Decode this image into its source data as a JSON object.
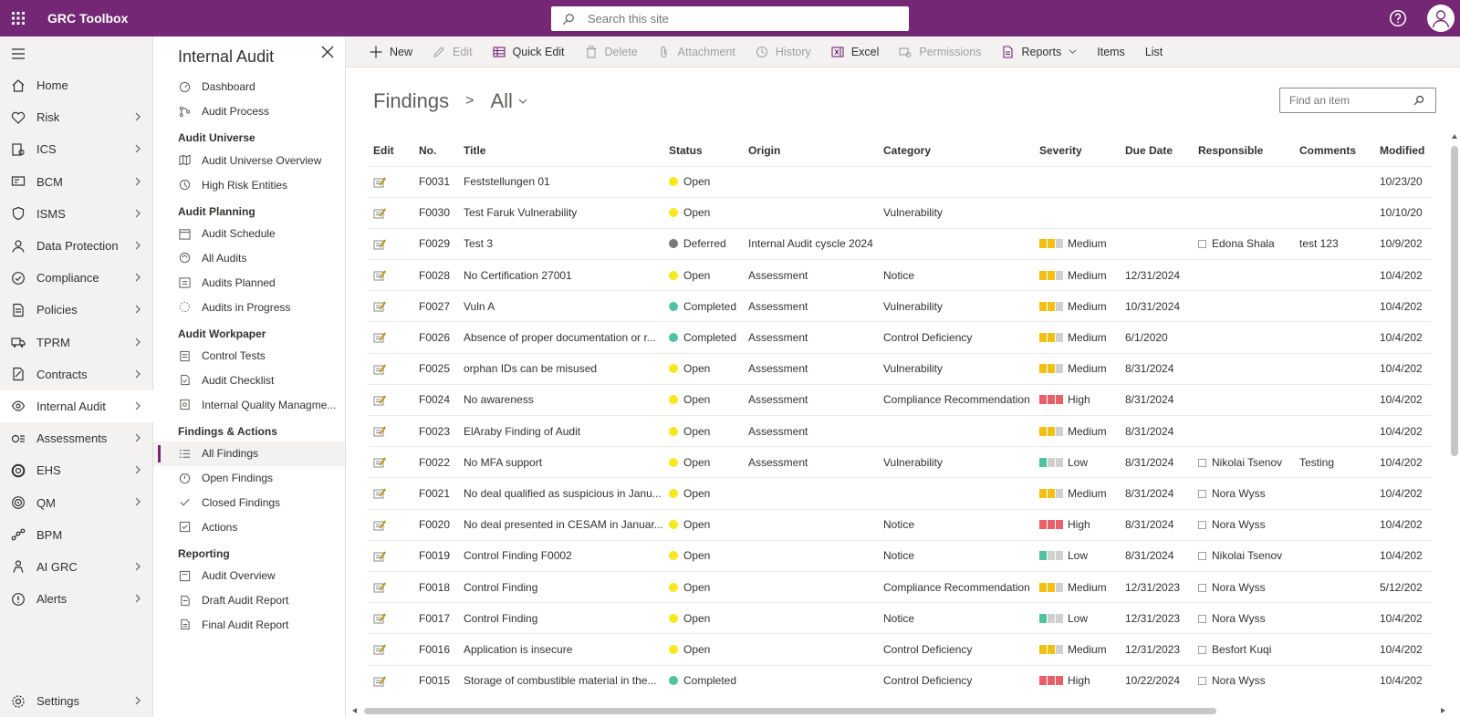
{
  "header": {
    "app_title": "GRC Toolbox",
    "search_placeholder": "Search this site"
  },
  "leftnav": {
    "items": [
      {
        "label": "Home",
        "icon": "home-icon",
        "chevron": false
      },
      {
        "label": "Risk",
        "icon": "risk-icon",
        "chevron": true
      },
      {
        "label": "ICS",
        "icon": "ics-icon",
        "chevron": true
      },
      {
        "label": "BCM",
        "icon": "bcm-icon",
        "chevron": true
      },
      {
        "label": "ISMS",
        "icon": "shield-icon",
        "chevron": true
      },
      {
        "label": "Data Protection",
        "icon": "person-icon",
        "chevron": true
      },
      {
        "label": "Compliance",
        "icon": "check-circle-icon",
        "chevron": true
      },
      {
        "label": "Policies",
        "icon": "policy-icon",
        "chevron": true
      },
      {
        "label": "TPRM",
        "icon": "truck-icon",
        "chevron": true
      },
      {
        "label": "Contracts",
        "icon": "contract-icon",
        "chevron": true
      },
      {
        "label": "Internal Audit",
        "icon": "eye-icon",
        "chevron": true
      },
      {
        "label": "Assessments",
        "icon": "assessment-icon",
        "chevron": true
      },
      {
        "label": "EHS",
        "icon": "lifebuoy-icon",
        "chevron": true
      },
      {
        "label": "QM",
        "icon": "target-icon",
        "chevron": true
      },
      {
        "label": "BPM",
        "icon": "flow-icon",
        "chevron": false
      },
      {
        "label": "AI GRC",
        "icon": "robot-icon",
        "chevron": true
      },
      {
        "label": "Alerts",
        "icon": "alert-icon",
        "chevron": true
      }
    ],
    "settings_label": "Settings"
  },
  "subnav": {
    "title": "Internal Audit",
    "top_items": [
      "Dashboard",
      "Audit Process"
    ],
    "groups": [
      {
        "heading": "Audit Universe",
        "items": [
          "Audit Universe Overview",
          "High Risk Entities"
        ]
      },
      {
        "heading": "Audit Planning",
        "items": [
          "Audit Schedule",
          "All Audits",
          "Audits Planned",
          "Audits in Progress"
        ]
      },
      {
        "heading": "Audit Workpaper",
        "items": [
          "Control Tests",
          "Audit Checklist",
          "Internal Quality Managme..."
        ]
      },
      {
        "heading": "Findings & Actions",
        "items": [
          "All Findings",
          "Open Findings",
          "Closed Findings",
          "Actions"
        ]
      },
      {
        "heading": "Reporting",
        "items": [
          "Audit Overview",
          "Draft Audit Report",
          "Final Audit Report"
        ]
      }
    ]
  },
  "commandbar": {
    "new": "New",
    "edit": "Edit",
    "quick_edit": "Quick Edit",
    "delete": "Delete",
    "attachment": "Attachment",
    "history": "History",
    "excel": "Excel",
    "permissions": "Permissions",
    "reports": "Reports",
    "items": "Items",
    "list": "List"
  },
  "main": {
    "list_name": "Findings",
    "separator": ">",
    "view_name": "All",
    "find_placeholder": "Find an item",
    "columns": [
      "Edit",
      "No.",
      "Title",
      "Status",
      "Origin",
      "Category",
      "Severity",
      "Due Date",
      "Responsible",
      "Comments",
      "Modified"
    ],
    "status_colors": {
      "Open": "#f8e71c",
      "Completed": "#4fc3a1",
      "Deferred": "#797775"
    },
    "severity_colors": {
      "Medium": [
        "#f2c014",
        "#f2c014",
        "#d2d0ce"
      ],
      "High": [
        "#e8606a",
        "#e8606a",
        "#e8606a"
      ],
      "Low": [
        "#4fc3a1",
        "#d2d0ce",
        "#d2d0ce"
      ]
    },
    "rows": [
      {
        "no": "F0031",
        "title": "Feststellungen 01",
        "status": "Open",
        "origin": "",
        "category": "",
        "severity": "",
        "due": "",
        "responsible": "",
        "comments": "",
        "modified": "10/23/20"
      },
      {
        "no": "F0030",
        "title": "Test Faruk Vulnerability",
        "status": "Open",
        "origin": "",
        "category": "Vulnerability",
        "severity": "",
        "due": "",
        "responsible": "",
        "comments": "",
        "modified": "10/10/20"
      },
      {
        "no": "F0029",
        "title": "Test 3",
        "status": "Deferred",
        "origin": "Internal Audit cyscle 2024",
        "category": "",
        "severity": "Medium",
        "due": "",
        "responsible": "Edona Shala",
        "comments": "test 123",
        "modified": "10/9/202"
      },
      {
        "no": "F0028",
        "title": "No Certification 27001",
        "status": "Open",
        "origin": "Assessment",
        "category": "Notice",
        "severity": "Medium",
        "due": "12/31/2024",
        "responsible": "",
        "comments": "",
        "modified": "10/4/202"
      },
      {
        "no": "F0027",
        "title": "Vuln A",
        "status": "Completed",
        "origin": "Assessment",
        "category": "Vulnerability",
        "severity": "Medium",
        "due": "10/31/2024",
        "responsible": "",
        "comments": "",
        "modified": "10/4/202"
      },
      {
        "no": "F0026",
        "title": "Absence of proper documentation or r...",
        "status": "Completed",
        "origin": "Assessment",
        "category": "Control Deficiency",
        "severity": "Medium",
        "due": "6/1/2020",
        "responsible": "",
        "comments": "",
        "modified": "10/4/202"
      },
      {
        "no": "F0025",
        "title": "orphan IDs can be misused",
        "status": "Open",
        "origin": "Assessment",
        "category": "Vulnerability",
        "severity": "Medium",
        "due": "8/31/2024",
        "responsible": "",
        "comments": "",
        "modified": "10/4/202"
      },
      {
        "no": "F0024",
        "title": "No awareness",
        "status": "Open",
        "origin": "Assessment",
        "category": "Compliance Recommendation",
        "severity": "High",
        "due": "8/31/2024",
        "responsible": "",
        "comments": "",
        "modified": "10/4/202"
      },
      {
        "no": "F0023",
        "title": "ElAraby Finding of Audit",
        "status": "Open",
        "origin": "Assessment",
        "category": "",
        "severity": "Medium",
        "due": "8/31/2024",
        "responsible": "",
        "comments": "",
        "modified": "10/4/202"
      },
      {
        "no": "F0022",
        "title": "No MFA support",
        "status": "Open",
        "origin": "Assessment",
        "category": "Vulnerability",
        "severity": "Low",
        "due": "8/31/2024",
        "responsible": "Nikolai Tsenov",
        "comments": "Testing",
        "modified": "10/4/202"
      },
      {
        "no": "F0021",
        "title": "No deal qualified as suspicious in Janu...",
        "status": "Open",
        "origin": "",
        "category": "",
        "severity": "Medium",
        "due": "8/31/2024",
        "responsible": "Nora Wyss",
        "comments": "",
        "modified": "10/4/202"
      },
      {
        "no": "F0020",
        "title": "No deal presented in CESAM in Januar...",
        "status": "Open",
        "origin": "",
        "category": "Notice",
        "severity": "High",
        "due": "8/31/2024",
        "responsible": "Nora Wyss",
        "comments": "",
        "modified": "10/4/202"
      },
      {
        "no": "F0019",
        "title": "Control Finding F0002",
        "status": "Open",
        "origin": "",
        "category": "Notice",
        "severity": "Low",
        "due": "8/31/2024",
        "responsible": "Nikolai Tsenov",
        "comments": "",
        "modified": "10/4/202"
      },
      {
        "no": "F0018",
        "title": "Control Finding",
        "status": "Open",
        "origin": "",
        "category": "Compliance Recommendation",
        "severity": "Medium",
        "due": "12/31/2023",
        "responsible": "Nora Wyss",
        "comments": "",
        "modified": "5/12/202"
      },
      {
        "no": "F0017",
        "title": "Control Finding",
        "status": "Open",
        "origin": "",
        "category": "Notice",
        "severity": "Low",
        "due": "12/31/2023",
        "responsible": "Nora Wyss",
        "comments": "",
        "modified": "10/4/202"
      },
      {
        "no": "F0016",
        "title": "Application is insecure",
        "status": "Open",
        "origin": "",
        "category": "Control Deficiency",
        "severity": "Medium",
        "due": "12/31/2023",
        "responsible": "Besfort Kuqi",
        "comments": "",
        "modified": "10/4/202"
      },
      {
        "no": "F0015",
        "title": "Storage of combustible material in the...",
        "status": "Completed",
        "origin": "",
        "category": "Control Deficiency",
        "severity": "High",
        "due": "10/22/2024",
        "responsible": "Nora Wyss",
        "comments": "",
        "modified": "10/4/202"
      }
    ]
  }
}
